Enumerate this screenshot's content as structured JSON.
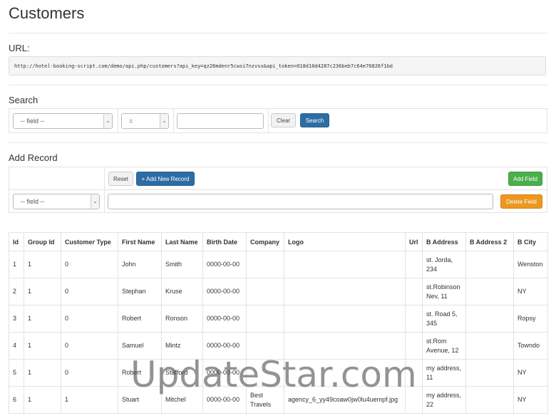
{
  "page": {
    "title": "Customers"
  },
  "url_section": {
    "label": "URL:",
    "value": "http://hotel-booking-script.com/demo/api.php/customers?api_key=qz26mdenr5cwsi7nzvsx&api_token=018d10d4287c236beb7c64e76826f1bd"
  },
  "search": {
    "label": "Search",
    "field_select": "-- field --",
    "operator_select": "=",
    "value_placeholder": "",
    "clear_label": "Clear",
    "search_label": "Search"
  },
  "add_record": {
    "label": "Add Record",
    "reset_label": "Reset",
    "add_new_label": "+ Add New Record",
    "add_field_label": "Add Field",
    "field_select": "-- field --",
    "delete_field_label": "Delete Field"
  },
  "table": {
    "columns": [
      "Id",
      "Group Id",
      "Customer Type",
      "First Name",
      "Last Name",
      "Birth Date",
      "Company",
      "Logo",
      "Url",
      "B Address",
      "B Address 2",
      "B City"
    ],
    "rows": [
      [
        "1",
        "1",
        "0",
        "John",
        "Smith",
        "0000-00-00",
        "",
        "",
        "",
        "st. Jorda, 234",
        "",
        "Wenston"
      ],
      [
        "2",
        "1",
        "0",
        "Stephan",
        "Kruse",
        "0000-00-00",
        "",
        "",
        "",
        "st.Robinson Nev, 11",
        "",
        "NY"
      ],
      [
        "3",
        "1",
        "0",
        "Robert",
        "Ronson",
        "0000-00-00",
        "",
        "",
        "",
        "st. Road 5, 345",
        "",
        "Ropsy"
      ],
      [
        "4",
        "1",
        "0",
        "Samuel",
        "Mintz",
        "0000-00-00",
        "",
        "",
        "",
        "st.Rom Avenue, 12",
        "",
        "Towndo"
      ],
      [
        "5",
        "1",
        "0",
        "Robert",
        "Stafford",
        "0000-00-00",
        "",
        "",
        "",
        "my address, 11",
        "",
        "NY"
      ],
      [
        "6",
        "1",
        "1",
        "Stuart",
        "Mitchel",
        "0000-00-00",
        "Best Travels",
        "agency_6_yy49coaw0jw0lu4uempf.jpg",
        "",
        "my address, 22",
        "",
        "NY"
      ]
    ]
  },
  "watermark": "UpdateStar.com",
  "colors": {
    "primary": "#2e6da4",
    "success": "#4cae4c",
    "warning": "#ec971f"
  }
}
